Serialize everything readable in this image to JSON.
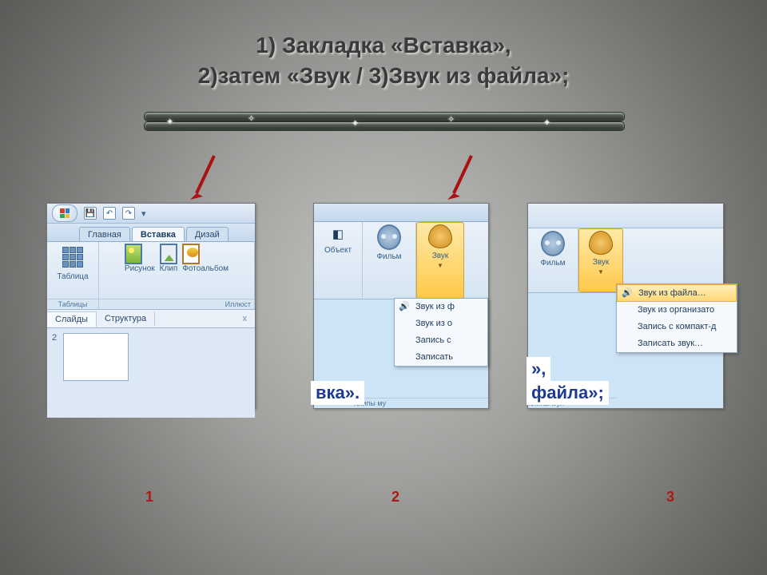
{
  "title": {
    "line1": "1) Закладка «Вставка»,",
    "line2": "2)затем  «Звук / 3)Звук из файла»;"
  },
  "step_labels": {
    "1": "1",
    "2": "2",
    "3": "3"
  },
  "shot1": {
    "qat": {
      "save": "💾",
      "undo": "↶",
      "redo": "↷",
      "more": "▾"
    },
    "tabs": {
      "home": "Главная",
      "insert": "Вставка",
      "design": "Дизай"
    },
    "groups": {
      "tables": {
        "btn": "Таблица",
        "footer": "Таблицы"
      },
      "images": {
        "pic": "Рисунок",
        "clip": "Клип",
        "album": "Фотоальбом",
        "footer": "Иллюст"
      }
    },
    "panes": {
      "slides": "Слайды",
      "outline": "Структура",
      "close": "x"
    },
    "thumb_num": "2"
  },
  "shot2": {
    "groups": {
      "object": "Объект",
      "movie": "Фильм",
      "sound": "Звук",
      "footer": "Клипы му"
    },
    "menu": [
      "Звук из ф",
      "Звук из о",
      "Запись с",
      "Записать"
    ],
    "fragment": "вка»."
  },
  "shot3": {
    "groups": {
      "movie": "Фильм",
      "sound": "Звук",
      "footer": "Клипы мул"
    },
    "menu": [
      "Звук из файла…",
      "Звук из организато",
      "Запись с компакт-д",
      "Записать звук…"
    ],
    "fragment1": "»,",
    "fragment2": "файла»;"
  }
}
